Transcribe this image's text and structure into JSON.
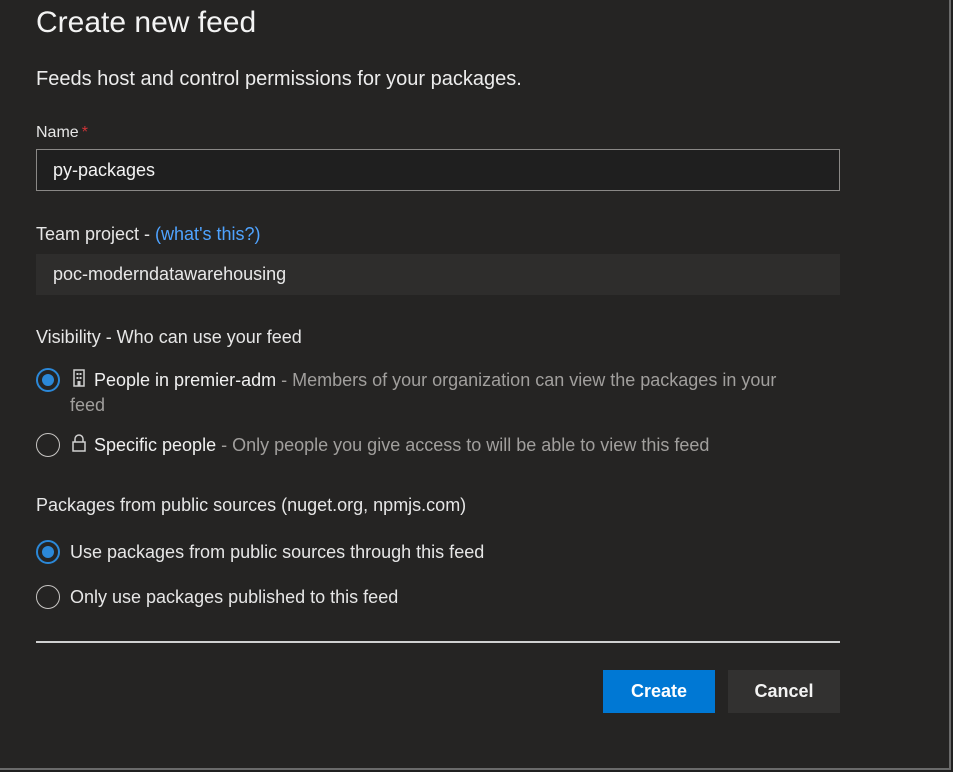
{
  "dialog": {
    "title": "Create new feed",
    "subtitle": "Feeds host and control permissions for your packages."
  },
  "name_field": {
    "label": "Name",
    "required_mark": "*",
    "value": "py-packages"
  },
  "team_project": {
    "label": "Team project - ",
    "help_link": "(what's this?)",
    "value": "poc-moderndatawarehousing"
  },
  "visibility": {
    "label": "Visibility - Who can use your feed",
    "options": [
      {
        "icon": "building-icon",
        "title": "People in premier-adm",
        "separator": " - ",
        "description": "Members of your organization can view the packages in your",
        "description_wrap": "feed",
        "selected": true
      },
      {
        "icon": "lock-icon",
        "title": "Specific people",
        "separator": " - ",
        "description": "Only people you give access to will be able to view this feed",
        "selected": false
      }
    ]
  },
  "public_sources": {
    "label": "Packages from public sources (nuget.org, npmjs.com)",
    "options": [
      {
        "label": "Use packages from public sources through this feed",
        "selected": true
      },
      {
        "label": "Only use packages published to this feed",
        "selected": false
      }
    ]
  },
  "actions": {
    "create_label": "Create",
    "cancel_label": "Cancel"
  },
  "colors": {
    "background": "#252423",
    "accent": "#0078d4",
    "radio_selected": "#2b88d8",
    "link": "#4fa3ff",
    "required": "#d13438"
  }
}
